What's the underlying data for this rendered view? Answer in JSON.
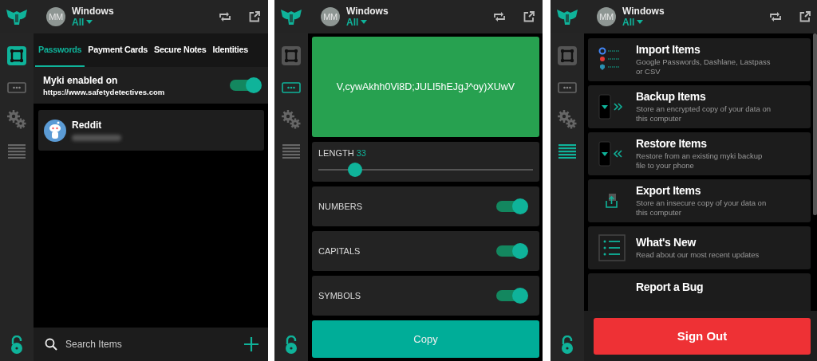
{
  "panels": [
    {
      "kind": "vault",
      "header": {
        "avatar": "MM",
        "device": "Windows",
        "filter": "All"
      },
      "nav": [
        {
          "kind": "vault",
          "selected": true
        },
        {
          "kind": "generator",
          "selected": false
        },
        {
          "kind": "settings",
          "selected": false
        },
        {
          "kind": "menu",
          "selected": false
        }
      ],
      "tabs": [
        {
          "label": "Passwords",
          "selected": true
        },
        {
          "label": "Payment Cards",
          "selected": false
        },
        {
          "label": "Secure Notes",
          "selected": false
        },
        {
          "label": "Identities",
          "selected": false
        }
      ],
      "site_banner": {
        "title": "Myki enabled on",
        "url": "https://www.safetydetectives.com",
        "on": true
      },
      "items": [
        {
          "name": "Reddit"
        }
      ],
      "search": {
        "placeholder": "Search Items"
      }
    },
    {
      "kind": "generator",
      "header": {
        "avatar": "MM",
        "device": "Windows",
        "filter": "All"
      },
      "nav": [
        {
          "kind": "vault",
          "selected": false
        },
        {
          "kind": "generator",
          "selected": true
        },
        {
          "kind": "settings",
          "selected": false
        },
        {
          "kind": "menu",
          "selected": false
        }
      ],
      "password": "V,cywAkhh0Vi8D;JULI5hEJgJ^oy)XUwV",
      "length": {
        "label": "LENGTH",
        "value": "33",
        "level": 0.17
      },
      "options": [
        {
          "label": "NUMBERS",
          "on": true
        },
        {
          "label": "CAPITALS",
          "on": true
        },
        {
          "label": "SYMBOLS",
          "on": true
        }
      ],
      "copy_button": "Copy"
    },
    {
      "kind": "settings",
      "header": {
        "avatar": "MM",
        "device": "Windows",
        "filter": "All"
      },
      "nav": [
        {
          "kind": "vault",
          "selected": false
        },
        {
          "kind": "generator",
          "selected": false
        },
        {
          "kind": "settings",
          "selected": false
        },
        {
          "kind": "menu",
          "selected": true
        }
      ],
      "actions": [
        {
          "kind": "import",
          "title": "Import Items",
          "description": "Google Passwords, Dashlane, Lastpass or CSV"
        },
        {
          "kind": "backup",
          "title": "Backup Items",
          "description": "Store an encrypted copy of your data on this computer"
        },
        {
          "kind": "restore",
          "title": "Restore Items",
          "description": "Restore from an existing myki backup file to your phone"
        },
        {
          "kind": "export",
          "title": "Export Items",
          "description": "Store an insecure copy of your data on this computer"
        },
        {
          "kind": "news",
          "title": "What's New",
          "description": "Read about our most recent updates"
        },
        {
          "kind": "bug",
          "title": "Report a Bug"
        }
      ],
      "sign_out_button": "Sign Out"
    }
  ]
}
